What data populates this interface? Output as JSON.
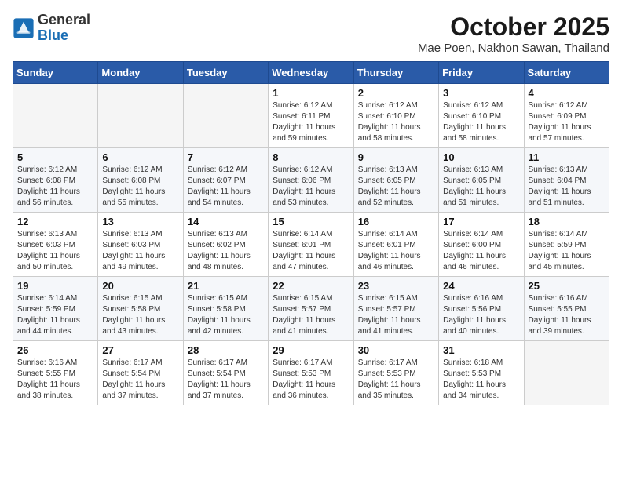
{
  "header": {
    "logo_general": "General",
    "logo_blue": "Blue",
    "month": "October 2025",
    "location": "Mae Poen, Nakhon Sawan, Thailand"
  },
  "days_of_week": [
    "Sunday",
    "Monday",
    "Tuesday",
    "Wednesday",
    "Thursday",
    "Friday",
    "Saturday"
  ],
  "weeks": [
    [
      {
        "day": "",
        "info": ""
      },
      {
        "day": "",
        "info": ""
      },
      {
        "day": "",
        "info": ""
      },
      {
        "day": "1",
        "info": "Sunrise: 6:12 AM\nSunset: 6:11 PM\nDaylight: 11 hours\nand 59 minutes."
      },
      {
        "day": "2",
        "info": "Sunrise: 6:12 AM\nSunset: 6:10 PM\nDaylight: 11 hours\nand 58 minutes."
      },
      {
        "day": "3",
        "info": "Sunrise: 6:12 AM\nSunset: 6:10 PM\nDaylight: 11 hours\nand 58 minutes."
      },
      {
        "day": "4",
        "info": "Sunrise: 6:12 AM\nSunset: 6:09 PM\nDaylight: 11 hours\nand 57 minutes."
      }
    ],
    [
      {
        "day": "5",
        "info": "Sunrise: 6:12 AM\nSunset: 6:08 PM\nDaylight: 11 hours\nand 56 minutes."
      },
      {
        "day": "6",
        "info": "Sunrise: 6:12 AM\nSunset: 6:08 PM\nDaylight: 11 hours\nand 55 minutes."
      },
      {
        "day": "7",
        "info": "Sunrise: 6:12 AM\nSunset: 6:07 PM\nDaylight: 11 hours\nand 54 minutes."
      },
      {
        "day": "8",
        "info": "Sunrise: 6:12 AM\nSunset: 6:06 PM\nDaylight: 11 hours\nand 53 minutes."
      },
      {
        "day": "9",
        "info": "Sunrise: 6:13 AM\nSunset: 6:05 PM\nDaylight: 11 hours\nand 52 minutes."
      },
      {
        "day": "10",
        "info": "Sunrise: 6:13 AM\nSunset: 6:05 PM\nDaylight: 11 hours\nand 51 minutes."
      },
      {
        "day": "11",
        "info": "Sunrise: 6:13 AM\nSunset: 6:04 PM\nDaylight: 11 hours\nand 51 minutes."
      }
    ],
    [
      {
        "day": "12",
        "info": "Sunrise: 6:13 AM\nSunset: 6:03 PM\nDaylight: 11 hours\nand 50 minutes."
      },
      {
        "day": "13",
        "info": "Sunrise: 6:13 AM\nSunset: 6:03 PM\nDaylight: 11 hours\nand 49 minutes."
      },
      {
        "day": "14",
        "info": "Sunrise: 6:13 AM\nSunset: 6:02 PM\nDaylight: 11 hours\nand 48 minutes."
      },
      {
        "day": "15",
        "info": "Sunrise: 6:14 AM\nSunset: 6:01 PM\nDaylight: 11 hours\nand 47 minutes."
      },
      {
        "day": "16",
        "info": "Sunrise: 6:14 AM\nSunset: 6:01 PM\nDaylight: 11 hours\nand 46 minutes."
      },
      {
        "day": "17",
        "info": "Sunrise: 6:14 AM\nSunset: 6:00 PM\nDaylight: 11 hours\nand 46 minutes."
      },
      {
        "day": "18",
        "info": "Sunrise: 6:14 AM\nSunset: 5:59 PM\nDaylight: 11 hours\nand 45 minutes."
      }
    ],
    [
      {
        "day": "19",
        "info": "Sunrise: 6:14 AM\nSunset: 5:59 PM\nDaylight: 11 hours\nand 44 minutes."
      },
      {
        "day": "20",
        "info": "Sunrise: 6:15 AM\nSunset: 5:58 PM\nDaylight: 11 hours\nand 43 minutes."
      },
      {
        "day": "21",
        "info": "Sunrise: 6:15 AM\nSunset: 5:58 PM\nDaylight: 11 hours\nand 42 minutes."
      },
      {
        "day": "22",
        "info": "Sunrise: 6:15 AM\nSunset: 5:57 PM\nDaylight: 11 hours\nand 41 minutes."
      },
      {
        "day": "23",
        "info": "Sunrise: 6:15 AM\nSunset: 5:57 PM\nDaylight: 11 hours\nand 41 minutes."
      },
      {
        "day": "24",
        "info": "Sunrise: 6:16 AM\nSunset: 5:56 PM\nDaylight: 11 hours\nand 40 minutes."
      },
      {
        "day": "25",
        "info": "Sunrise: 6:16 AM\nSunset: 5:55 PM\nDaylight: 11 hours\nand 39 minutes."
      }
    ],
    [
      {
        "day": "26",
        "info": "Sunrise: 6:16 AM\nSunset: 5:55 PM\nDaylight: 11 hours\nand 38 minutes."
      },
      {
        "day": "27",
        "info": "Sunrise: 6:17 AM\nSunset: 5:54 PM\nDaylight: 11 hours\nand 37 minutes."
      },
      {
        "day": "28",
        "info": "Sunrise: 6:17 AM\nSunset: 5:54 PM\nDaylight: 11 hours\nand 37 minutes."
      },
      {
        "day": "29",
        "info": "Sunrise: 6:17 AM\nSunset: 5:53 PM\nDaylight: 11 hours\nand 36 minutes."
      },
      {
        "day": "30",
        "info": "Sunrise: 6:17 AM\nSunset: 5:53 PM\nDaylight: 11 hours\nand 35 minutes."
      },
      {
        "day": "31",
        "info": "Sunrise: 6:18 AM\nSunset: 5:53 PM\nDaylight: 11 hours\nand 34 minutes."
      },
      {
        "day": "",
        "info": ""
      }
    ]
  ]
}
